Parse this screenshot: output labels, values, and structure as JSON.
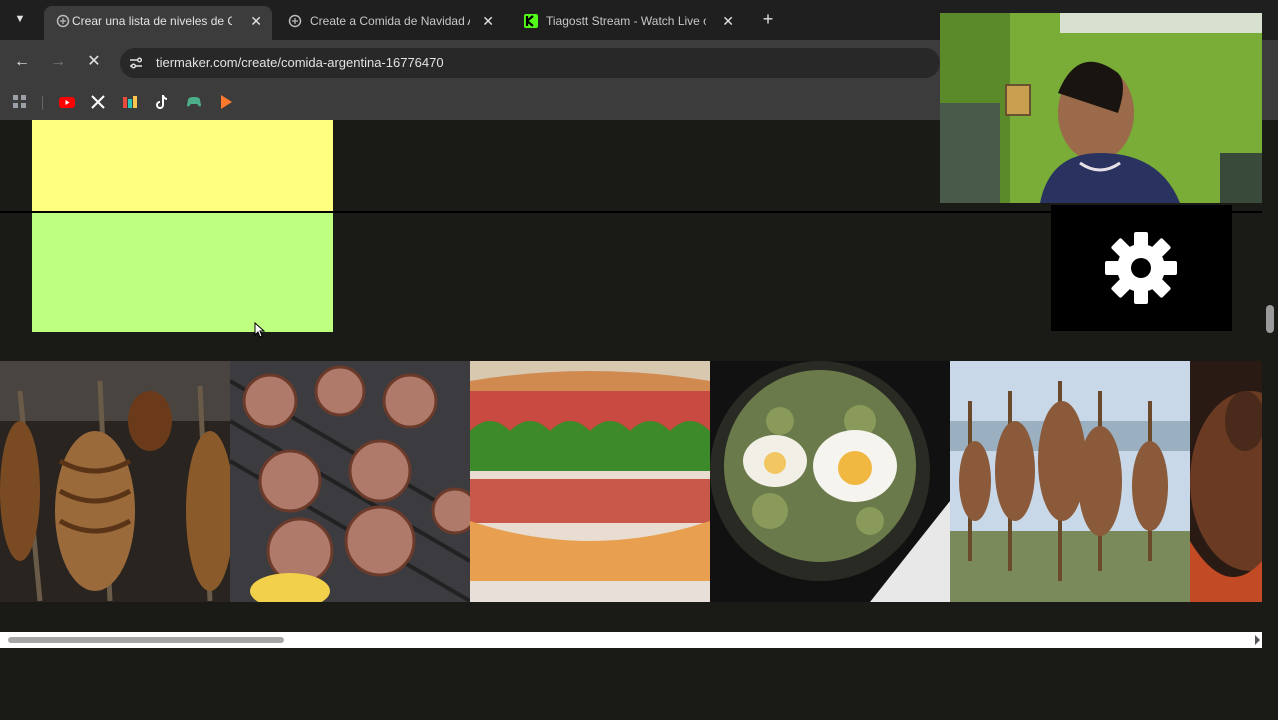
{
  "browser": {
    "tabs": [
      {
        "title": "Crear una lista de niveles de Co",
        "active": true,
        "favicon": "tiermaker-icon"
      },
      {
        "title": "Create a Comida de Navidad Ar",
        "active": false,
        "favicon": "tiermaker-icon"
      },
      {
        "title": "Tiagostt Stream - Watch Live o",
        "active": false,
        "favicon": "kick-icon"
      }
    ],
    "address": {
      "url": "tiermaker.com/create/comida-argentina-16776470",
      "loading": true
    },
    "bookmarks": [
      "apps-icon",
      "youtube-icon",
      "x-icon",
      "colorful-app-icon",
      "tiktok-icon",
      "gamepad-icon",
      "play-icon"
    ]
  },
  "tierlist": {
    "tiers": [
      {
        "color": "#ffff7f"
      },
      {
        "color": "#bfff7f"
      }
    ],
    "pool_items": [
      "food-asado-ribs",
      "food-grilled-sausages",
      "food-choripan-sandwich",
      "food-eggs-spinach-pan",
      "food-lamb-roasting-crosses",
      "food-stew-pot"
    ]
  },
  "colors": {
    "accent_green_kick": "#53fc18",
    "tier_yellow": "#ffff7f",
    "tier_green": "#bfff7f"
  }
}
